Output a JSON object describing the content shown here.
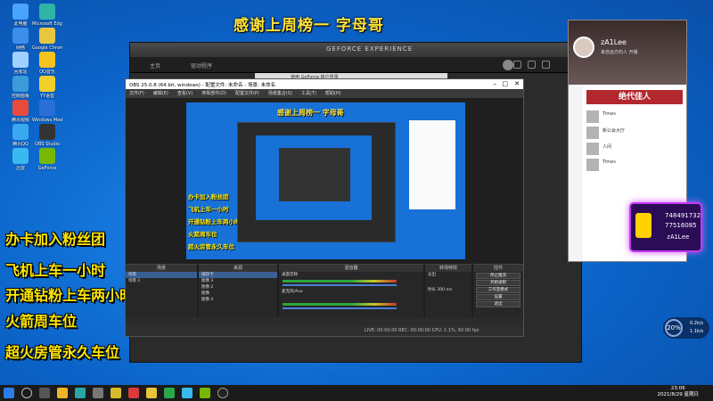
{
  "banner": {
    "title": "感谢上周榜一  字母哥"
  },
  "promos": [
    "办卡加入粉丝团",
    "飞机上车一小时",
    "开通钻粉上车两小时",
    "火箭周车位",
    "超火房管永久车位"
  ],
  "desktop_icons": [
    {
      "label": "此电脑",
      "color": "#4aa3ff"
    },
    {
      "label": "Microsoft Edge",
      "color": "#2fb5a8"
    },
    {
      "label": "网络",
      "color": "#3c8ee8"
    },
    {
      "label": "Google Chrome",
      "color": "#e8c73c"
    },
    {
      "label": "回收站",
      "color": "#9fd0ff"
    },
    {
      "label": "QQ音乐",
      "color": "#f6c21c"
    },
    {
      "label": "控制面板",
      "color": "#3a9bd8"
    },
    {
      "label": "YY语音",
      "color": "#f2d02a"
    },
    {
      "label": "腾讯视频",
      "color": "#e84b3c"
    },
    {
      "label": "Windows Media",
      "color": "#2a6ed8"
    },
    {
      "label": "腾讯QQ",
      "color": "#3aa8f0"
    },
    {
      "label": "OBS Studio",
      "color": "#333333"
    },
    {
      "label": "迅雷",
      "color": "#3ab8f0"
    },
    {
      "label": "GeForce",
      "color": "#76b900"
    }
  ],
  "gfe": {
    "brand": "GEFORCE EXPERIENCE",
    "tab_home": "主页",
    "tab_drivers": "驱动程序",
    "sub_text": "使用 GeForce 账户登录"
  },
  "obs": {
    "title": "OBS 25.0.8 (64 bit, windows) - 配置文件: 未命名 - 场景: 未命名",
    "menu": [
      "文件(F)",
      "编辑(E)",
      "查看(V)",
      "停靠部件(D)",
      "配置文件(P)",
      "场景集合(S)",
      "工具(T)",
      "帮助(H)"
    ],
    "preview_title": "感谢上周榜一 字母哥",
    "preview_promos": [
      "办卡加入粉丝团",
      "飞机上车一小时",
      "开通钻粉上车两小时",
      "火箭周车位",
      "超火房管永久车位"
    ],
    "docks": {
      "scenes": {
        "header": "场景",
        "items": [
          "场景",
          "场景 2"
        ]
      },
      "sources": {
        "header": "来源",
        "items": [
          "捕获卡",
          "图像 3",
          "图像 2",
          "图像",
          "图像 4"
        ]
      },
      "mixer": {
        "header": "混音器",
        "tracks": [
          "桌面音频",
          "麦克风/Aux"
        ]
      },
      "transitions": {
        "header": "转场特效",
        "mode": "淡出",
        "duration_label": "时长",
        "duration": "300 ms"
      },
      "controls": {
        "header": "控件",
        "buttons": [
          "停止推流",
          "开始录制",
          "工作室模式",
          "设置",
          "退出"
        ]
      }
    },
    "status": "LIVE: 00:00:00   REC: 00:00:00   CPU: 1.1%, 60.00 fps"
  },
  "yy": {
    "name": "zA1Lee",
    "desc": "来自远方的人  开播",
    "banner": "绝代佳人",
    "items": [
      "Times",
      "新公会大厅",
      "人间",
      "Times"
    ]
  },
  "card": {
    "line1": "748491732",
    "line2": "77516085",
    "username": "zA1Lee"
  },
  "sysmon": {
    "percent": "20%",
    "up": "0.2k/s",
    "down": "1.1k/s"
  },
  "taskbar": {
    "time": "23:06",
    "date": "2021/8/29 星期日"
  }
}
